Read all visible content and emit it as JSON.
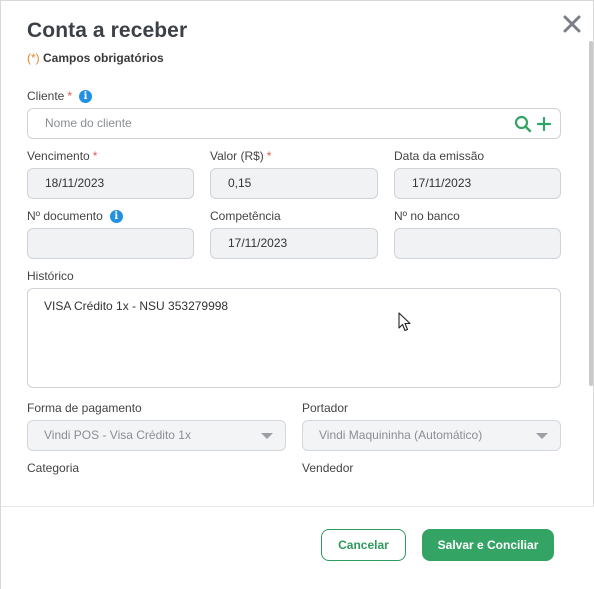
{
  "dialog": {
    "title": "Conta a receber",
    "required_asterisk": "(*)",
    "required_note": "Campos obrigatórios"
  },
  "cliente": {
    "label": "Cliente",
    "required": "*",
    "info": "i",
    "placeholder": "Nome do cliente"
  },
  "vencimento": {
    "label": "Vencimento",
    "required": "*",
    "value": "18/11/2023"
  },
  "valor": {
    "label": "Valor (R$)",
    "required": "*",
    "value": "0,15"
  },
  "data_emissao": {
    "label": "Data da emissão",
    "value": "17/11/2023"
  },
  "documento": {
    "label": "Nº documento",
    "info": "i",
    "value": ""
  },
  "competencia": {
    "label": "Competência",
    "value": "17/11/2023"
  },
  "no_banco": {
    "label": "Nº no banco",
    "value": ""
  },
  "historico": {
    "label": "Histórico",
    "value": "VISA Crédito 1x - NSU 353279998"
  },
  "forma_pagamento": {
    "label": "Forma de pagamento",
    "value": "Vindi POS - Visa Crédito 1x"
  },
  "portador": {
    "label": "Portador",
    "value": "Vindi Maquininha (Automático)"
  },
  "categoria": {
    "label": "Categoria"
  },
  "vendedor": {
    "label": "Vendedor"
  },
  "footer": {
    "cancel_label": "Cancelar",
    "save_label": "Salvar e Conciliar"
  },
  "colors": {
    "accent_green": "#34a465",
    "info_blue": "#2291e0",
    "required_red": "#e2574c",
    "note_orange": "#e28a2b"
  },
  "icons": [
    "close-icon",
    "info-icon",
    "search-icon",
    "plus-icon",
    "chevron-down-icon",
    "mouse-cursor-icon"
  ]
}
